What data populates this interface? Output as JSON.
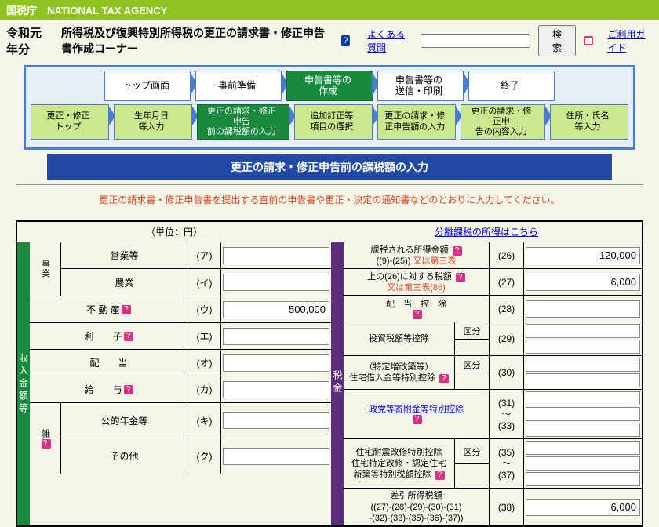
{
  "header": {
    "agency": "国税庁　NATIONAL TAX AGENCY",
    "year": "令和元年分",
    "title": "所得税及び復興特別所得税の更正の請求書・修正申告書作成コーナー",
    "faq": "よくある質問",
    "search_btn": "検　索",
    "guide": "ご利用ガイド"
  },
  "nav1": [
    "トップ画面",
    "事前準備",
    "申告書等の\n作成",
    "申告書等の\n送信・印刷",
    "終了"
  ],
  "nav2": [
    "更正・修正\nトップ",
    "生年月日\n等入力",
    "更正の請求・修正申告\n前の課税額の入力",
    "追加訂正等\n項目の選択",
    "更正の請求・修\n正申告額の入力",
    "更正の請求・修正申\n告の内容入力",
    "住所・氏名\n等入力"
  ],
  "banner": "更正の請求・修正申告前の課税額の入力",
  "instruction": "更正の請求書・修正申告書を提出する直前の申告書や更正・決定の通知書などのとおりに入力してください。",
  "unit": "（単位：円）",
  "separate_link": "分離課税の所得はこちら",
  "spine_left": "収入金額等",
  "spine_mid": "税金",
  "left": {
    "jigyo": "事業",
    "eigyo": "営業等",
    "nogyo": "農業",
    "fudosan": "不 動 産",
    "rishi": "利　　子",
    "haito": "配　　当",
    "kyuyo": "給　　与",
    "zatsu": "雑",
    "nenkin": "公的年金等",
    "sonota": "その他",
    "kana": {
      "a": "(ア)",
      "i": "(イ)",
      "u": "(ウ)",
      "e": "(エ)",
      "o": "(オ)",
      "ka": "(カ)",
      "ki": "(キ)",
      "ku": "(ク)"
    },
    "val": {
      "fudosan": "500,000"
    }
  },
  "right": {
    "r26": {
      "t1": "課税される所得金額",
      "t2": "((9)-(25))",
      "t3": "又は第三表",
      "n": "(26)",
      "v": "120,000"
    },
    "r27": {
      "t1": "上の(26)に対する税額",
      "t2": "又は第三表(86)",
      "n": "(27)",
      "v": "6,000"
    },
    "r28": {
      "t": "配　当　控　除",
      "n": "(28)"
    },
    "r29": {
      "t": "投資税額等控除",
      "k": "区分",
      "n": "(29)"
    },
    "r30": {
      "t1": "（特定増改築等）",
      "t2": "住宅借入金等特別控除",
      "k": "区分",
      "n": "(30)"
    },
    "r31": {
      "t": "政党等寄附金等特別控除",
      "n": "(31)\n～\n(33)"
    },
    "r35": {
      "t1": "住宅耐震改修特別控除",
      "t2": "住宅特定改修・認定住宅",
      "t3": "新築等特別税額控除",
      "k": "区分",
      "n": "(35)\n～\n(37)"
    },
    "r38": {
      "t1": "差引所得税額",
      "t2": "((27)-(28)-(29)-(30)-(31)",
      "t3": "-(32)-(33)-(35)-(36)-(37))",
      "n": "(38)",
      "v": "6,000"
    }
  }
}
